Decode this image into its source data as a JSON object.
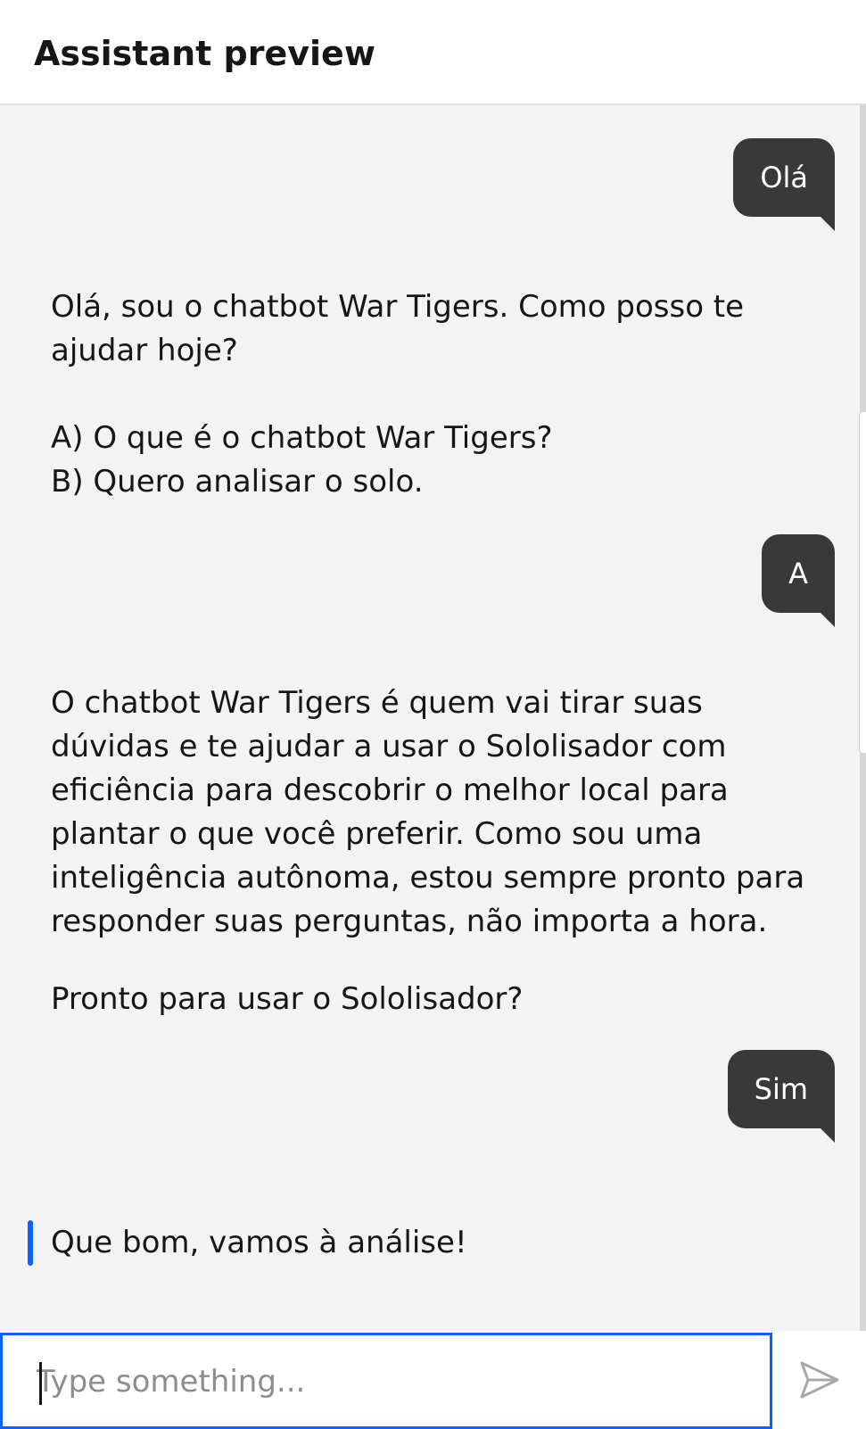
{
  "header": {
    "title": "Assistant preview"
  },
  "messages": [
    {
      "role": "user",
      "text": "Olá"
    },
    {
      "role": "bot",
      "paragraphs": [
        "Olá, sou o chatbot War Tigers. Como posso te ajudar hoje?",
        "A) O que é o chatbot War Tigers?",
        "B) Quero analisar o solo."
      ]
    },
    {
      "role": "user",
      "text": "A"
    },
    {
      "role": "bot",
      "paragraphs": [
        "O chatbot War Tigers é quem vai tirar suas dúvidas e te ajudar a usar o Sololisador com eficiência para descobrir o melhor local para plantar o que você preferir. Como sou uma inteligência autônoma, estou sempre pronto para responder suas perguntas, não importa a hora.",
        "Pronto para usar o Sololisador?"
      ]
    },
    {
      "role": "user",
      "text": "Sim"
    },
    {
      "role": "bot",
      "paragraphs": [
        "Que bom, vamos à análise!"
      ]
    }
  ],
  "composer": {
    "placeholder": "Type something...",
    "value": "",
    "send_icon": "send-icon"
  },
  "colors": {
    "accent": "#0f62fe",
    "user_bubble": "#393939",
    "chat_background": "#f3f3f3"
  }
}
